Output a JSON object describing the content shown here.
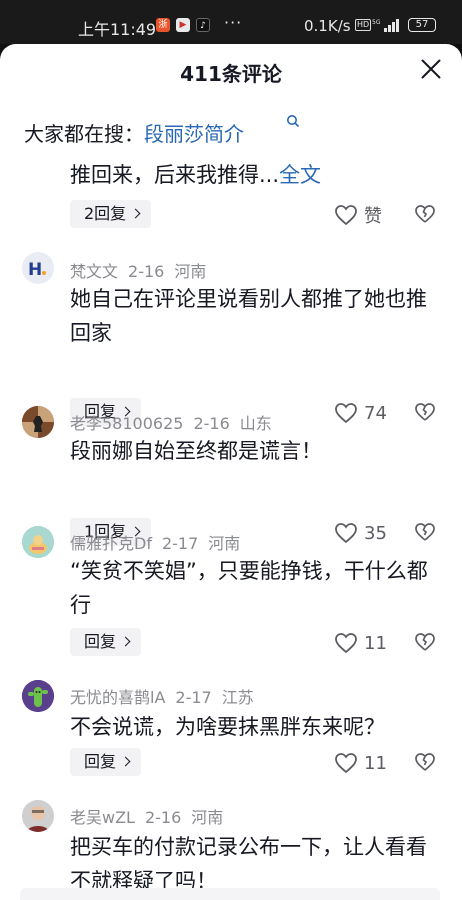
{
  "status_bar": {
    "time": "上午11:49",
    "more": "···",
    "net_speed": "0.1K/s",
    "hd": "HD",
    "network": "5G",
    "battery": "57"
  },
  "sheet": {
    "title": "411条评论",
    "search": {
      "prefix": "大家都在搜：",
      "keyword": "段丽莎简介"
    }
  },
  "comments": [
    {
      "text": "推回来，后来我推得...",
      "more": "全文",
      "reply_label": "2回复",
      "like_label": "赞"
    },
    {
      "user": "梵文文",
      "date": "2-16",
      "region": "河南",
      "text": "她自己在评论里说看别人都推了她也推回家",
      "reply_label": "回复",
      "likes": "74"
    },
    {
      "user": "老李58100625",
      "date": "2-16",
      "region": "山东",
      "text": "段丽娜自始至终都是谎言！",
      "reply_label": "1回复",
      "likes": "35"
    },
    {
      "user": "儒雅扑克Df",
      "date": "2-17",
      "region": "河南",
      "text": "“笑贫不笑娼”，只要能挣钱，干什么都行",
      "reply_label": "回复",
      "likes": "11"
    },
    {
      "user": "无忧的喜鹊lA",
      "date": "2-17",
      "region": "江苏",
      "text": "不会说谎，为啥要抹黑胖东来呢？",
      "reply_label": "回复",
      "likes": "11"
    },
    {
      "user": "老吴wZL",
      "date": "2-16",
      "region": "河南",
      "text": "把买车的付款记录公布一下，让人看看不就释疑了吗！"
    }
  ]
}
